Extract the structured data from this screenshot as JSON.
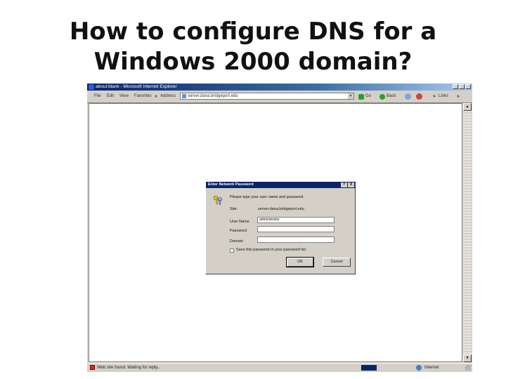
{
  "slide": {
    "title_line1": "How to configure DNS for a",
    "title_line2": "Windows 2000 domain?"
  },
  "browser": {
    "window_title": "about:blank - Microsoft Internet Explorer",
    "menu": [
      "File",
      "Edit",
      "View",
      "Favorites"
    ],
    "more_menu_chevron": "»",
    "address_label": "Address",
    "address_value": "server.dana.bridgeport.edu",
    "go_label": "Go",
    "back_label": "Back",
    "links_label": "Links",
    "toolbar_chevron": "»",
    "status_text": "Web site found. Waiting for reply...",
    "status_zone": "Internet"
  },
  "dialog": {
    "title": "Enter Network Password",
    "help_btn": "?",
    "close_btn": "X",
    "prompt": "Please type your user name and password.",
    "site_label": "Site:",
    "site_value": "server.dana.bridgeport.edu",
    "user_label": "User Name",
    "user_value": "administrator",
    "password_label": "Password",
    "password_value": "",
    "domain_label": "Domain",
    "domain_value": "",
    "save_label": "Save this password in your password list",
    "save_checked": false,
    "ok_label": "OK",
    "cancel_label": "Cancel"
  },
  "colors": {
    "titlebar": "#0a246a",
    "chrome": "#d4d0c8",
    "content_bg": "#ffffff"
  },
  "icons": [
    "ie-icon",
    "page-icon",
    "go-arrow-icon",
    "back-arrow-icon",
    "keys-icon",
    "globe-icon",
    "error-icon"
  ]
}
